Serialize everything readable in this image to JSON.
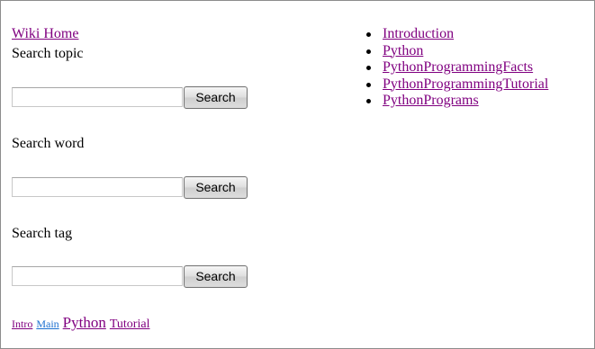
{
  "nav": {
    "home_label": "Wiki Home"
  },
  "search": {
    "topic": {
      "label": "Search topic",
      "value": "",
      "button": "Search"
    },
    "word": {
      "label": "Search word",
      "value": "",
      "button": "Search"
    },
    "tag": {
      "label": "Search tag",
      "value": "",
      "button": "Search"
    }
  },
  "tag_cloud": [
    {
      "label": "Intro",
      "color": "#800080"
    },
    {
      "label": "Main",
      "color": "#1a6fd0"
    },
    {
      "label": "Python",
      "color": "#800080"
    },
    {
      "label": "Tutorial",
      "color": "#800080"
    }
  ],
  "topics": [
    {
      "label": "Introduction"
    },
    {
      "label": "Python"
    },
    {
      "label": "PythonProgrammingFacts"
    },
    {
      "label": "PythonProgrammingTutorial"
    },
    {
      "label": "PythonPrograms"
    }
  ],
  "colors": {
    "visited_link": "#800080",
    "link": "#1a6fd0",
    "border": "#8c8c8c"
  }
}
